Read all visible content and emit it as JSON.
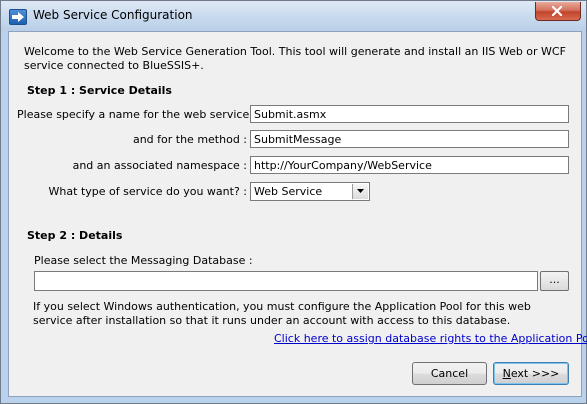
{
  "window": {
    "title": "Web Service Configuration"
  },
  "intro": "Welcome to the  Web Service Generation Tool.  This tool will generate and install an IIS Web or WCF service connected to BlueSSIS+.",
  "step1": {
    "heading": "Step 1 : Service Details",
    "name_label": "Please specify a name for the web service :",
    "name_value": "Submit.asmx",
    "method_label": "and for the method :",
    "method_value": "SubmitMessage",
    "namespace_label": "and an associated namespace :",
    "namespace_value": "http://YourCompany/WebService",
    "type_label": "What type of service do you want? :",
    "type_selected": "Web Service"
  },
  "step2": {
    "heading": "Step 2 :  Details",
    "db_label": "Please select the Messaging Database :",
    "db_value": "",
    "browse_label": "...",
    "info_text": "If you select Windows authentication, you must configure the Application Pool for this web service after installation so that it runs under an account with access to this database.",
    "link_text": "Click here to assign database rights to the Application Pool"
  },
  "buttons": {
    "cancel_label": "Cancel",
    "next_label": "Next >>>"
  },
  "icons": {
    "app": "arrow-right-icon",
    "close": "close-icon",
    "dropdown": "chevron-down-icon"
  },
  "colors": {
    "link": "#0000cc",
    "close_button": "#c0452c",
    "title_bar": "#c9dbee",
    "dialog_background": "#f0f0f0"
  }
}
